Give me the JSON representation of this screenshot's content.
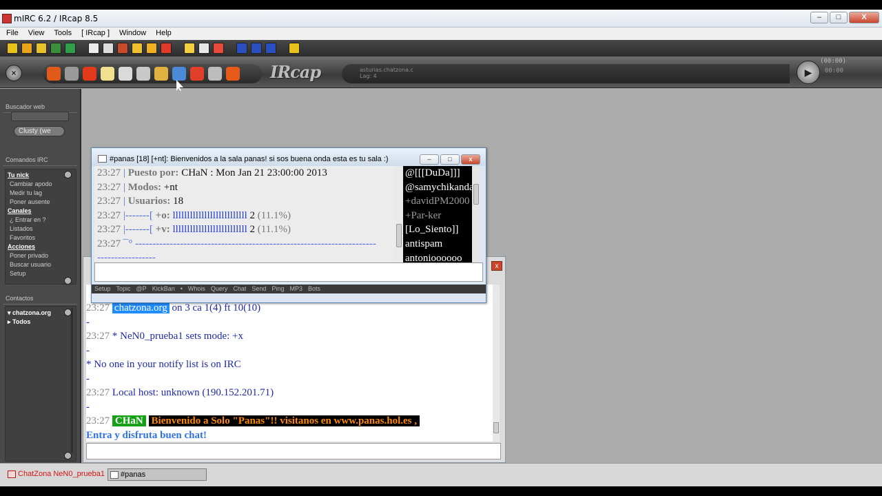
{
  "app": {
    "title": "mIRC 6.2 / IRcap 8.5",
    "window_buttons": {
      "minimize": "–",
      "maximize": "□",
      "close": "X"
    }
  },
  "menu": [
    "File",
    "View",
    "Tools",
    "[ IRcap ]",
    "Window",
    "Help"
  ],
  "toolbar1_icons": [
    {
      "name": "connect-icon",
      "color": "#e8c21a"
    },
    {
      "name": "options-icon",
      "color": "#e8a31a"
    },
    {
      "name": "folder-icon",
      "color": "#e6c12a"
    },
    {
      "name": "address-book-icon",
      "color": "#3c8f3a"
    },
    {
      "name": "script-icon",
      "color": "#2e9e4a"
    },
    {
      "name": "log-icon",
      "color": "#ececec"
    },
    {
      "name": "timer-icon",
      "color": "#dcdcdc"
    },
    {
      "name": "colors-icon",
      "color": "#c84a2a"
    },
    {
      "name": "channels-icon",
      "color": "#f0c030"
    },
    {
      "name": "notify-icon",
      "color": "#f0b020"
    },
    {
      "name": "list-icon",
      "color": "#e03a2a"
    },
    {
      "name": "dcc-send-icon",
      "color": "#f2d040"
    },
    {
      "name": "dcc-chat-icon",
      "color": "#e8e8e8"
    },
    {
      "name": "dcc-options-icon",
      "color": "#e74a3a"
    },
    {
      "name": "tile-icon",
      "color": "#2a4fbf"
    },
    {
      "name": "cascade-icon",
      "color": "#2a4fbf"
    },
    {
      "name": "arrange-icon",
      "color": "#2a4fbf"
    },
    {
      "name": "about-icon",
      "color": "#e8c21a"
    }
  ],
  "toolbar2_icons": [
    {
      "name": "smiley-icon",
      "color": "#e05a1a"
    },
    {
      "name": "brush-icon",
      "color": "#9a9a9a"
    },
    {
      "name": "pencil-icon",
      "color": "#e23a1a"
    },
    {
      "name": "note-icon",
      "color": "#f0e090"
    },
    {
      "name": "globe-icon",
      "color": "#dadada"
    },
    {
      "name": "tools-icon",
      "color": "#c8c8c8"
    },
    {
      "name": "gift-icon",
      "color": "#e0b040"
    },
    {
      "name": "puzzle-icon",
      "color": "#4a8ad8"
    },
    {
      "name": "toys-icon",
      "color": "#e0402a"
    },
    {
      "name": "ircap-logo-icon",
      "color": "#bdbdbd"
    },
    {
      "name": "refresh-icon",
      "color": "#e85a1a"
    }
  ],
  "logo": "IRcap",
  "lcd": {
    "server": "asturias.chatzona.c",
    "lag": "Lag: 4"
  },
  "player": {
    "time1": "(00:00)",
    "time2": "00:00"
  },
  "sidebar": {
    "buscador_title": "Buscador web",
    "search_button": "Clusty (we",
    "comandos_title": "Comandos IRC",
    "commands": [
      {
        "label": "Tu nick",
        "type": "head"
      },
      {
        "label": "Cambiar apodo",
        "type": "sub"
      },
      {
        "label": "Medir tu lag",
        "type": "sub"
      },
      {
        "label": "Poner ausente",
        "type": "sub"
      },
      {
        "label": "Canales",
        "type": "head"
      },
      {
        "label": "¿ Entrar en ?",
        "type": "sub"
      },
      {
        "label": "Listados",
        "type": "sub"
      },
      {
        "label": "Favoritos",
        "type": "sub"
      },
      {
        "label": "Acciones",
        "type": "head"
      },
      {
        "label": "Poner privado",
        "type": "sub"
      },
      {
        "label": "Buscar usuario",
        "type": "sub"
      },
      {
        "label": "Setup",
        "type": "sub"
      }
    ],
    "contactos_title": "Contactos",
    "contacts": [
      "chatzona.org",
      "Todos"
    ]
  },
  "channel_window": {
    "title": "#panas [18] [+nt]:  Bienvenidos a la sala panas! si sos buena onda esta es tu sala :)",
    "lines": [
      {
        "ts": "23:27",
        "pre": "|",
        "label": "Puesto por:",
        "value": "CHaN : Mon Jan 21 23:00:00 2013"
      },
      {
        "ts": "23:27",
        "pre": "|",
        "label": "Modos:",
        "value": "+nt"
      },
      {
        "ts": "23:27",
        "pre": "|",
        "label": "Usuarios:",
        "value": "18"
      },
      {
        "ts": "23:27",
        "pre": "|-------[",
        "label": "+o:",
        "bar": "llllllllllllllllllllllllll",
        "value": "2",
        "pct": "(11.1%)"
      },
      {
        "ts": "23:27",
        "pre": "|-------[",
        "label": "+v:",
        "bar": "llllllllllllllllllllllllll",
        "value": "2",
        "pct": "(11.1%)"
      },
      {
        "ts": "23:27",
        "pre": "¯°",
        "dashes": "----------------------------------------------------------------------"
      },
      {
        "ts": "",
        "pre": "",
        "dashes": "-----------------"
      }
    ],
    "nicks": [
      {
        "nick": "@[[[DuDa]]]",
        "kind": "op"
      },
      {
        "nick": "@samychikanda",
        "kind": "op"
      },
      {
        "nick": "+davidPM2000",
        "kind": "voice"
      },
      {
        "nick": "+Par-ker",
        "kind": "voice"
      },
      {
        "nick": "[Lo_Siento]]",
        "kind": "reg"
      },
      {
        "nick": "antispam",
        "kind": "reg"
      },
      {
        "nick": "antonioooooo",
        "kind": "reg"
      }
    ],
    "bottom_bar": [
      "Setup",
      "Topic",
      "@P",
      "KickBan",
      "•",
      "Whois",
      "Query",
      "Chat",
      "Send",
      "Ping",
      "MP3",
      "Bots"
    ]
  },
  "status_window": {
    "partial_top": "... ...... ...... ... ... ... ... ...........",
    "lines": [
      {
        "ts": "23:27",
        "highlight": "chatzona.org",
        "text": " on 3 ca 1(4) ft 10(10)"
      },
      {
        "text": "-"
      },
      {
        "ts": "23:27",
        "text": " * NeN0_prueba1 sets mode: +x"
      },
      {
        "text": "-"
      },
      {
        "text": "* No one in your notify list is on IRC"
      },
      {
        "text": "-"
      },
      {
        "ts": "23:27",
        "text": " Local host: unknown (190.152.201.71)"
      },
      {
        "text": "-"
      },
      {
        "ts": "23:27",
        "nick": "CHaN",
        "message": "Bienvenido a Solo \"Panas\"!! visitanos en www.panas.hol.es ,"
      },
      {
        "continuation": " Entra y disfruta buen chat!"
      }
    ]
  },
  "taskbar": {
    "items": [
      "ChatZona NeN0_prueba1",
      "#panas"
    ]
  }
}
